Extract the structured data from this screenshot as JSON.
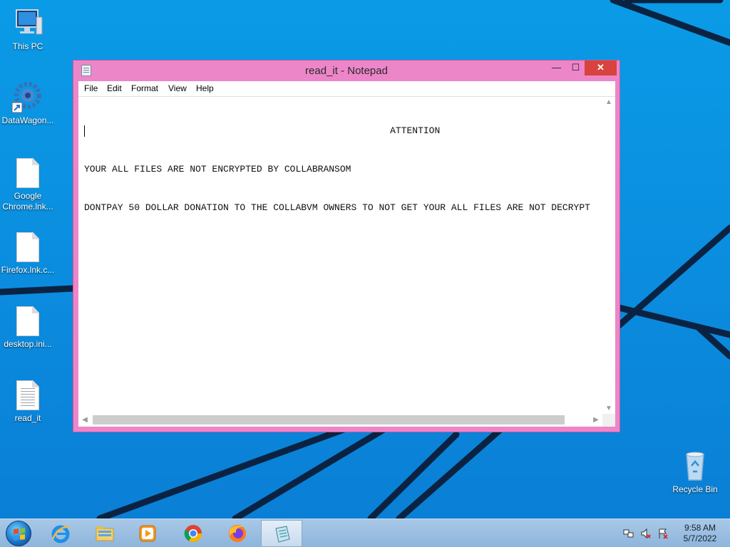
{
  "desktop": {
    "icons": [
      {
        "label": "This PC"
      },
      {
        "label": "DataWagon..."
      },
      {
        "label": "Google Chrome.lnk..."
      },
      {
        "label": "Firefox.lnk.c..."
      },
      {
        "label": "desktop.ini..."
      },
      {
        "label": "read_it"
      },
      {
        "label": "Recycle Bin"
      }
    ]
  },
  "window": {
    "title": "read_it - Notepad",
    "controls": {
      "minimize": "—",
      "maximize": "☐",
      "close": "✕"
    },
    "menu": [
      "File",
      "Edit",
      "Format",
      "View",
      "Help"
    ],
    "lines": [
      "                                                       ATTENTION",
      "YOUR ALL FILES ARE NOT ENCRYPTED BY COLLABRANSOM",
      "DONTPAY 50 DOLLAR DONATION TO THE COLLABVM OWNERS TO NOT GET YOUR ALL FILES ARE NOT DECRYPT"
    ],
    "scroll": {
      "up": "▲",
      "down": "▼",
      "left": "◀",
      "right": "▶"
    }
  },
  "taskbar": {
    "pinned": [
      {
        "name": "Internet Explorer",
        "icon": "internet-explorer-icon"
      },
      {
        "name": "File Explorer",
        "icon": "folder-icon"
      },
      {
        "name": "Windows Media Player",
        "icon": "media-player-icon"
      },
      {
        "name": "Google Chrome",
        "icon": "chrome-icon"
      },
      {
        "name": "Firefox",
        "icon": "firefox-icon"
      },
      {
        "name": "Notepad",
        "icon": "notepad-icon"
      }
    ],
    "time": "9:58 AM",
    "date": "5/7/2022"
  },
  "colors": {
    "desktop": "#0a9be6",
    "window_frame": "#ec86c9",
    "close_button": "#d8433d",
    "taskbar": "#a9c8e6"
  }
}
